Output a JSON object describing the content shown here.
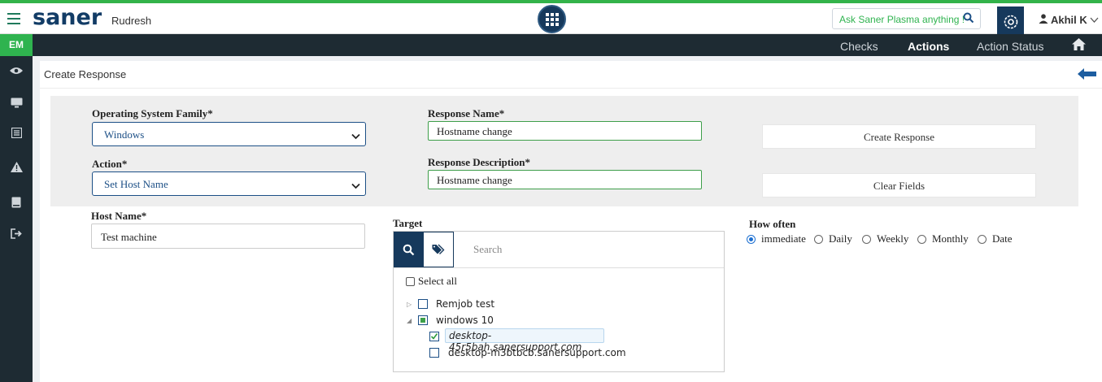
{
  "header": {
    "brand": "saner",
    "org": "Rudresh",
    "ask_label": "Ask Saner Plasma anything !",
    "user_name": "Akhil K"
  },
  "nav": {
    "module_badge": "EM",
    "links": [
      "Checks",
      "Actions",
      "Action Status"
    ],
    "active": "Actions"
  },
  "sidebar": {
    "icons": [
      "eye-icon",
      "monitor-icon",
      "list-icon",
      "warning-icon",
      "book-icon",
      "sign-out-icon"
    ]
  },
  "page": {
    "title": "Create Response"
  },
  "form": {
    "os_family_label": "Operating System Family*",
    "os_family_value": "Windows",
    "action_label": "Action*",
    "action_value": "Set Host Name",
    "response_name_label": "Response Name*",
    "response_name_value": "Hostname change",
    "response_desc_label": "Response Description*",
    "response_desc_value": "Hostname change",
    "create_button": "Create Response",
    "clear_button": "Clear Fields",
    "host_name_label": "Host Name*",
    "host_name_value": "Test machine"
  },
  "target": {
    "label": "Target",
    "search_placeholder": "Search",
    "select_all": "Select all",
    "groups": [
      {
        "name": "Remjob test",
        "expanded": false,
        "checked": false
      },
      {
        "name": "windows 10",
        "expanded": true,
        "checked": "partial",
        "children": [
          {
            "name": "desktop-45r5bah.sanersupport.com",
            "checked": true
          },
          {
            "name": "desktop-m3btbcb.sanersupport.com",
            "checked": false
          }
        ]
      }
    ]
  },
  "schedule": {
    "label": "How often",
    "options": [
      "immediate",
      "Daily",
      "Weekly",
      "Monthly",
      "Date"
    ],
    "selected": "immediate"
  },
  "colors": {
    "navy": "#16395c",
    "green": "#2fb34f",
    "dark_bar": "#1e2b33"
  }
}
